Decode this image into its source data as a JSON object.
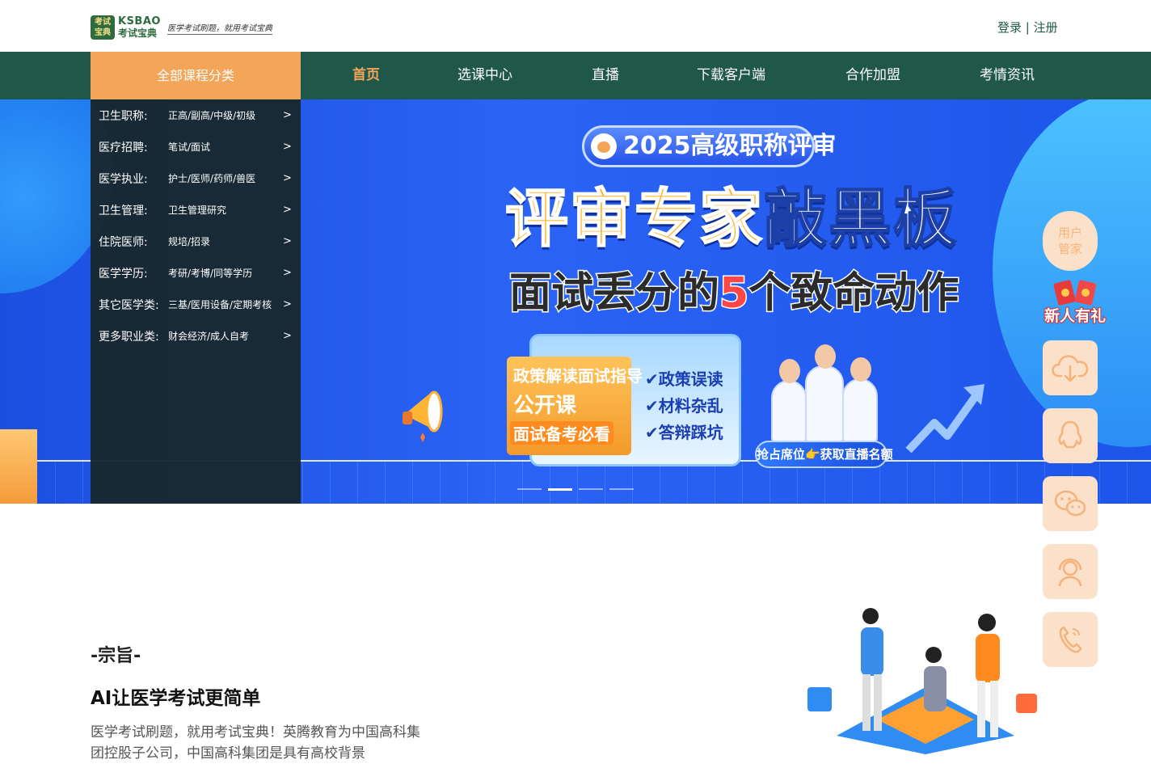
{
  "header": {
    "logo": {
      "badge": "考试\n宝典",
      "brand_en": "KSBAO",
      "brand_cn": "考试宝典",
      "slogan": "医学考试刷题，就用考试宝典"
    },
    "login": "登录",
    "separator": " | ",
    "register": "注册"
  },
  "nav": {
    "all_courses": "全部课程分类",
    "items": [
      {
        "label": "首页",
        "active": true
      },
      {
        "label": "选课中心"
      },
      {
        "label": "直播"
      },
      {
        "label": "下载客户端"
      },
      {
        "label": "合作加盟"
      },
      {
        "label": "考情资讯"
      }
    ]
  },
  "categories": [
    {
      "name": "卫生职称:",
      "sub": "正高/副高/中级/初级",
      "arrow": ">"
    },
    {
      "name": "医疗招聘:",
      "sub": "笔试/面试",
      "arrow": ">"
    },
    {
      "name": "医学执业:",
      "sub": "护士/医师/药师/兽医",
      "arrow": ">"
    },
    {
      "name": "卫生管理:",
      "sub": "卫生管理研究",
      "arrow": ">"
    },
    {
      "name": "住院医师:",
      "sub": "规培/招录",
      "arrow": ">"
    },
    {
      "name": "医学学历:",
      "sub": "考研/考博/同等学历",
      "arrow": ">"
    },
    {
      "name": "其它医学类:",
      "sub": "三基/医用设备/定期考核",
      "arrow": ">"
    },
    {
      "name": "更多职业类:",
      "sub": "财会经济/成人自考",
      "arrow": ">"
    }
  ],
  "banner": {
    "pill": "2025高级职称评审",
    "headline_a": "评审专家",
    "headline_b": "敲黑板",
    "sub_a": "面试丢分的",
    "sub_num": "5",
    "sub_b": "个致命动作",
    "card": {
      "line1": "政策解读面试指导",
      "line2": "公开课",
      "line3": "面试备考必看"
    },
    "checks": [
      "✔政策误读",
      "✔材料杂乱",
      "✔答辩踩坑"
    ],
    "cta": "抢占席位👉获取直播名额",
    "slide_active_index": 1,
    "slide_count": 4
  },
  "sidebar": {
    "user_manager_1": "用户",
    "user_manager_2": "管家",
    "new_user_gift": "新人有礼",
    "icons": [
      "cloud-download-icon",
      "qq-icon",
      "wechat-icon",
      "customer-service-icon",
      "phone-icon"
    ]
  },
  "mission": {
    "tag": "-宗旨-",
    "title": "AI让医学考试更简单",
    "desc": "医学考试刷题，就用考试宝典！英腾教育为中国高科集团控股子公司，中国高科集团是具有高校背景"
  },
  "colors": {
    "nav_bg": "#1f5748",
    "accent": "#f3a55a",
    "menu_bg": "#182830",
    "float_bg": "#fbe1ca",
    "banner_blue": "#2a63f5"
  }
}
